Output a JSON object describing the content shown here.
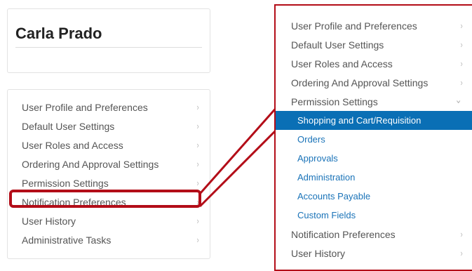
{
  "profile": {
    "name": "Carla Prado"
  },
  "left_menu": {
    "items": [
      {
        "label": "User Profile and Preferences"
      },
      {
        "label": "Default User Settings"
      },
      {
        "label": "User Roles and Access"
      },
      {
        "label": "Ordering And Approval Settings"
      },
      {
        "label": "Permission Settings"
      },
      {
        "label": "Notification Preferences"
      },
      {
        "label": "User History"
      },
      {
        "label": "Administrative Tasks"
      }
    ]
  },
  "zoom_menu": {
    "items": [
      {
        "label": "User Profile and Preferences"
      },
      {
        "label": "Default User Settings"
      },
      {
        "label": "User Roles and Access"
      },
      {
        "label": "Ordering And Approval Settings"
      },
      {
        "label": "Permission Settings"
      }
    ],
    "sub_items": [
      {
        "label": "Shopping and Cart/Requisition"
      },
      {
        "label": "Orders"
      },
      {
        "label": "Approvals"
      },
      {
        "label": "Administration"
      },
      {
        "label": "Accounts Payable"
      },
      {
        "label": "Custom Fields"
      }
    ],
    "trailing_items": [
      {
        "label": "Notification Preferences"
      },
      {
        "label": "User History"
      }
    ]
  },
  "icons": {
    "chevron_right": "›",
    "chevron_down": "⌄"
  },
  "colors": {
    "highlight": "#b30d18",
    "active_bg": "#0a6fb5",
    "link": "#1a73b8"
  }
}
